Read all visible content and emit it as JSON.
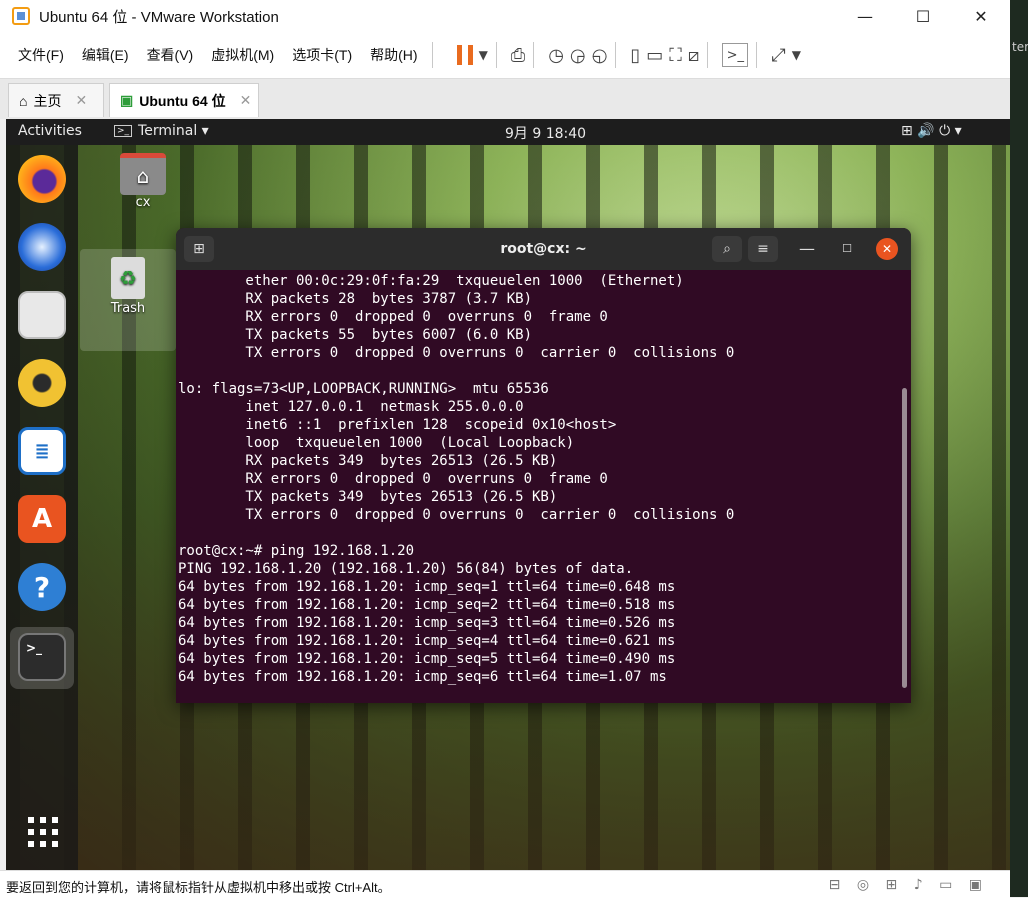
{
  "window": {
    "title": "Ubuntu 64 位 - VMware Workstation",
    "controls": {
      "minimize": "—",
      "maximize": "☐",
      "close": "✕"
    },
    "edge_text": "ter"
  },
  "menu": {
    "items": [
      "文件(F)",
      "编辑(E)",
      "查看(V)",
      "虚拟机(M)",
      "选项卡(T)",
      "帮助(H)"
    ]
  },
  "tabs": [
    {
      "label": "主页",
      "close": "✕"
    },
    {
      "label": "Ubuntu 64 位",
      "close": "✕"
    }
  ],
  "gnome": {
    "activities": "Activities",
    "app_menu": "Terminal ▾",
    "clock": "9月 9  18:40",
    "tray": "⊞  🔊  ⏻ ▾"
  },
  "desktop_icons": [
    {
      "label": "cx"
    },
    {
      "label": "Trash"
    }
  ],
  "terminal": {
    "title": "root@cx: ~",
    "lines": [
      "        ether 00:0c:29:0f:fa:29  txqueuelen 1000  (Ethernet)",
      "        RX packets 28  bytes 3787 (3.7 KB)",
      "        RX errors 0  dropped 0  overruns 0  frame 0",
      "        TX packets 55  bytes 6007 (6.0 KB)",
      "        TX errors 0  dropped 0 overruns 0  carrier 0  collisions 0",
      "",
      "lo: flags=73<UP,LOOPBACK,RUNNING>  mtu 65536",
      "        inet 127.0.0.1  netmask 255.0.0.0",
      "        inet6 ::1  prefixlen 128  scopeid 0x10<host>",
      "        loop  txqueuelen 1000  (Local Loopback)",
      "        RX packets 349  bytes 26513 (26.5 KB)",
      "        RX errors 0  dropped 0  overruns 0  frame 0",
      "        TX packets 349  bytes 26513 (26.5 KB)",
      "        TX errors 0  dropped 0 overruns 0  carrier 0  collisions 0",
      "",
      "root@cx:~# ping 192.168.1.20",
      "PING 192.168.1.20 (192.168.1.20) 56(84) bytes of data.",
      "64 bytes from 192.168.1.20: icmp_seq=1 ttl=64 time=0.648 ms",
      "64 bytes from 192.168.1.20: icmp_seq=2 ttl=64 time=0.518 ms",
      "64 bytes from 192.168.1.20: icmp_seq=3 ttl=64 time=0.526 ms",
      "64 bytes from 192.168.1.20: icmp_seq=4 ttl=64 time=0.621 ms",
      "64 bytes from 192.168.1.20: icmp_seq=5 ttl=64 time=0.490 ms",
      "64 bytes from 192.168.1.20: icmp_seq=6 ttl=64 time=1.07 ms"
    ]
  },
  "statusbar": {
    "message": "要返回到您的计算机，请将鼠标指针从虚拟机中移出或按 Ctrl+Alt。",
    "icons": "⊟ ◎ ⊞ ♪ ▭ ▣"
  },
  "icons": {
    "app": "vmware-icon",
    "home": "home-icon",
    "vm_tab": "vm-icon",
    "terminal_app": "terminal-icon"
  },
  "colors": {
    "terminal_bg": "#300a24",
    "pause_accent": "#e96b1f",
    "close_button": "#e95420"
  }
}
